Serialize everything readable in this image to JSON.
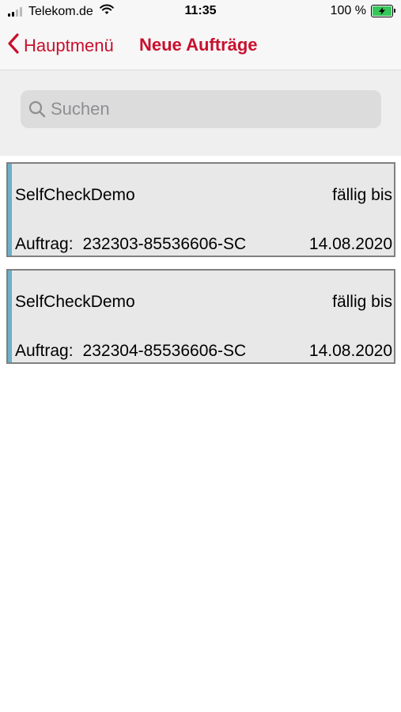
{
  "status_bar": {
    "carrier": "Telekom.de",
    "time": "11:35",
    "battery": "100 %",
    "battery_level": 1.0
  },
  "nav": {
    "back_label": "Hauptmenü",
    "title": "Neue Aufträge",
    "accent_color": "#c8102e"
  },
  "search": {
    "placeholder": "Suchen"
  },
  "orders": [
    {
      "name": "SelfCheckDemo",
      "due_label": "fällig bis",
      "order_label": "Auftrag:",
      "order_number": "232303-85536606-SC",
      "due_date": "14.08.2020"
    },
    {
      "name": "SelfCheckDemo",
      "due_label": "fällig bis",
      "order_label": "Auftrag:",
      "order_number": "232304-85536606-SC",
      "due_date": "14.08.2020"
    }
  ],
  "icons": {
    "signal": "cellular-signal-icon",
    "wifi": "wifi-icon",
    "battery": "battery-charging-icon",
    "back": "chevron-left-icon",
    "search": "search-icon"
  }
}
